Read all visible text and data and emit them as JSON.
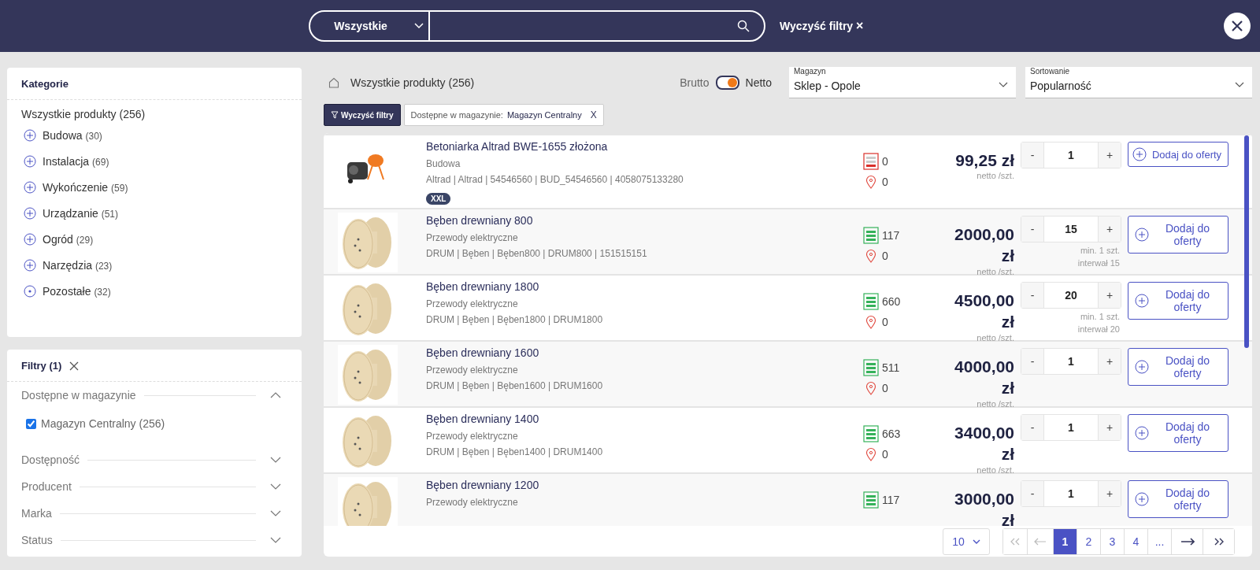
{
  "header": {
    "category_select": "Wszystkie",
    "clear_filters": "Wyczyść filtry",
    "clear_icon": "×"
  },
  "categories": {
    "title": "Kategorie",
    "all": "Wszystkie produkty (256)",
    "items": [
      {
        "name": "Budowa",
        "count": "(30)",
        "expandable": true
      },
      {
        "name": "Instalacja",
        "count": "(69)",
        "expandable": true
      },
      {
        "name": "Wykończenie",
        "count": "(59)",
        "expandable": true
      },
      {
        "name": "Urządzanie",
        "count": "(51)",
        "expandable": true
      },
      {
        "name": "Ogród",
        "count": "(29)",
        "expandable": true
      },
      {
        "name": "Narzędzia",
        "count": "(23)",
        "expandable": true
      },
      {
        "name": "Pozostałe",
        "count": "(32)",
        "expandable": false
      }
    ]
  },
  "filters": {
    "title": "Filtry (1)",
    "groups": [
      {
        "name": "Dostępne w magazynie",
        "expanded": true,
        "options": [
          {
            "label": "Magazyn Centralny (256)",
            "checked": true
          }
        ]
      },
      {
        "name": "Dostępność",
        "expanded": false
      },
      {
        "name": "Producent",
        "expanded": false
      },
      {
        "name": "Marka",
        "expanded": false
      },
      {
        "name": "Status",
        "expanded": false
      }
    ]
  },
  "breadcrumb": "Wszystkie produkty (256)",
  "price_toggle": {
    "left": "Brutto",
    "right": "Netto",
    "netto_on": true
  },
  "selects": [
    {
      "label": "Magazyn",
      "value": "Sklep - Opole"
    },
    {
      "label": "Sortowanie",
      "value": "Popularność"
    }
  ],
  "active_filters": {
    "clear_button": "Wyczyść filtry",
    "chips": [
      {
        "label": "Dostępne w magazynie:",
        "value": "Magazyn Centralny",
        "remove": "X"
      }
    ]
  },
  "products": [
    {
      "name": "Betoniarka Altrad BWE-1655 złożona",
      "category": "Budowa",
      "codes": "Altrad | Altrad | 54546560 | BUD_54546560 | 4058075133280",
      "badge": "XXL",
      "in_stock": false,
      "stock": "0",
      "location_stock": "0",
      "price": "99,25 zł",
      "price_unit": "netto /szt.",
      "decrease": "-",
      "quantity": "1",
      "increase": "+",
      "add_button": "Dodaj do oferty"
    },
    {
      "name": "Bęben drewniany 800",
      "category": "Przewody elektryczne",
      "codes": "DRUM | Bęben | Bęben800 | DRUM800 | 151515151",
      "in_stock": true,
      "stock": "117",
      "location_stock": "0",
      "price": "2000,00 zł",
      "price_unit": "netto /szt.",
      "decrease": "-",
      "quantity": "15",
      "increase": "+",
      "notes": [
        "min. 1 szt.",
        "interwał 15"
      ],
      "add_button": "Dodaj do oferty"
    },
    {
      "name": "Bęben drewniany 1800",
      "category": "Przewody elektryczne",
      "codes": "DRUM | Bęben | Bęben1800 | DRUM1800",
      "in_stock": true,
      "stock": "660",
      "location_stock": "0",
      "price": "4500,00 zł",
      "price_unit": "netto /szt.",
      "decrease": "-",
      "quantity": "20",
      "increase": "+",
      "notes": [
        "min. 1 szt.",
        "interwał 20"
      ],
      "add_button": "Dodaj do oferty"
    },
    {
      "name": "Bęben drewniany 1600",
      "category": "Przewody elektryczne",
      "codes": "DRUM | Bęben | Bęben1600 | DRUM1600",
      "in_stock": true,
      "stock": "511",
      "location_stock": "0",
      "price": "4000,00 zł",
      "price_unit": "netto /szt.",
      "decrease": "-",
      "quantity": "1",
      "increase": "+",
      "add_button": "Dodaj do oferty"
    },
    {
      "name": "Bęben drewniany 1400",
      "category": "Przewody elektryczne",
      "codes": "DRUM | Bęben | Bęben1400 | DRUM1400",
      "in_stock": true,
      "stock": "663",
      "location_stock": "0",
      "price": "3400,00 zł",
      "price_unit": "netto /szt.",
      "decrease": "-",
      "quantity": "1",
      "increase": "+",
      "add_button": "Dodaj do oferty"
    },
    {
      "name": "Bęben drewniany 1200",
      "category": "Przewody elektryczne",
      "in_stock": true,
      "stock": "117",
      "price": "3000,00 zł",
      "decrease": "-",
      "quantity": "1",
      "increase": "+",
      "add_button": "Dodaj do oferty"
    }
  ],
  "pagination": {
    "page_size": "10",
    "first_disabled": true,
    "prev_disabled": true,
    "pages": [
      {
        "label": "1",
        "selected": true
      },
      {
        "label": "2",
        "selected": false
      },
      {
        "label": "3",
        "selected": false
      },
      {
        "label": "4",
        "selected": false
      },
      {
        "label": "...",
        "selected": false
      }
    ]
  }
}
